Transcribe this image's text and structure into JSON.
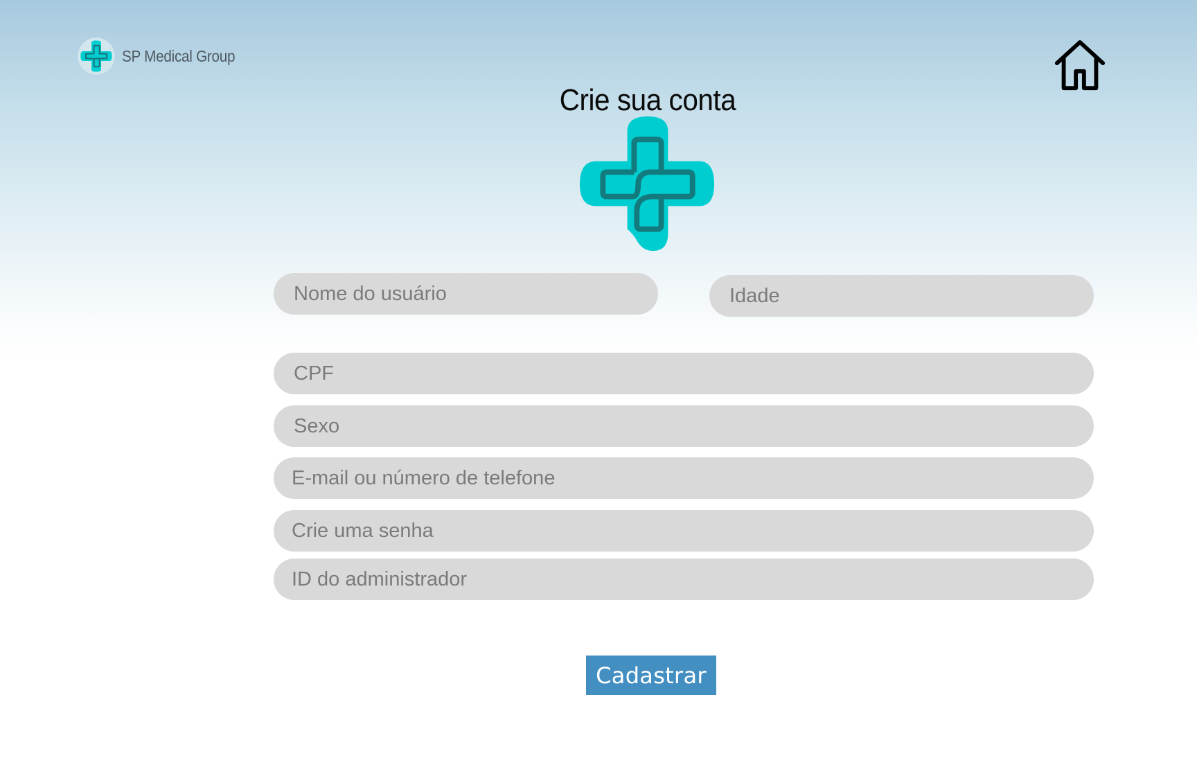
{
  "brand": {
    "name": "SP Medical Group",
    "logo_icon": "medical-cross-logo-icon",
    "accent_color": "#00cdd0",
    "accent_dark": "#1a8a8c"
  },
  "header": {
    "home_icon": "home-icon"
  },
  "page": {
    "title": "Crie sua conta"
  },
  "form": {
    "username_placeholder": "Nome do usuário",
    "age_placeholder": "Idade",
    "cpf_placeholder": "CPF",
    "sex_placeholder": "Sexo",
    "contact_placeholder": "E-mail ou número de telefone",
    "password_placeholder": "Crie uma senha",
    "admin_id_placeholder": "ID do administrador",
    "submit_label": "Cadastrar",
    "input_bg": "#d9d9d9",
    "submit_bg": "#438fc2"
  }
}
